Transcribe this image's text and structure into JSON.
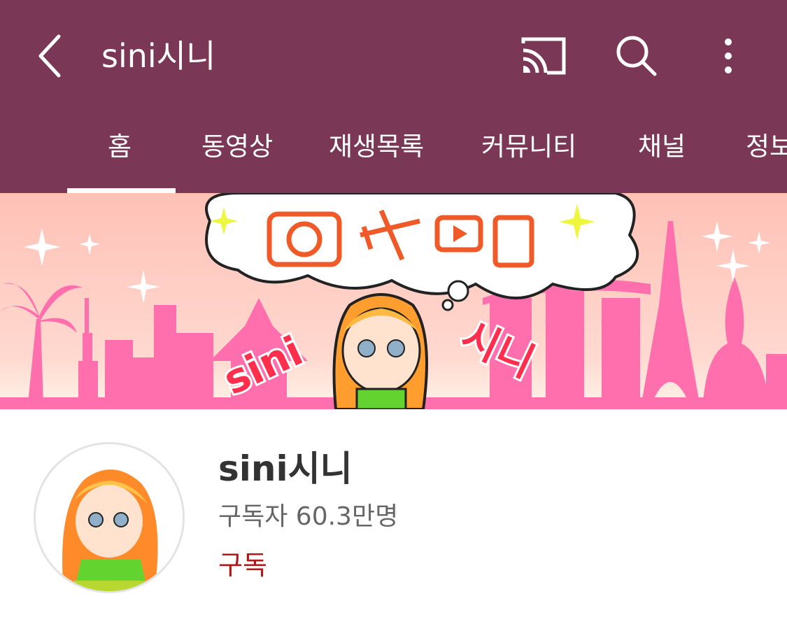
{
  "header": {
    "title": "sini시니",
    "background_color": "#7b3856",
    "icons": [
      "back-arrow-icon",
      "cast-icon",
      "search-icon",
      "more-vert-icon"
    ]
  },
  "tabs": [
    {
      "label": "홈",
      "selected": true
    },
    {
      "label": "동영상",
      "selected": false
    },
    {
      "label": "재생목록",
      "selected": false
    },
    {
      "label": "커뮤니티",
      "selected": false
    },
    {
      "label": "채널",
      "selected": false
    },
    {
      "label": "정보",
      "selected": false
    }
  ],
  "banner": {
    "logo_text_left": "sini",
    "logo_text_right": "시니",
    "background_color": "#ffc7b5",
    "skyline_color": "#ff6fae"
  },
  "channel": {
    "name": "sini시니",
    "subscribers": "구독자 60.3만명",
    "subscribe_label": "구독",
    "subscribe_color": "#b11818"
  }
}
